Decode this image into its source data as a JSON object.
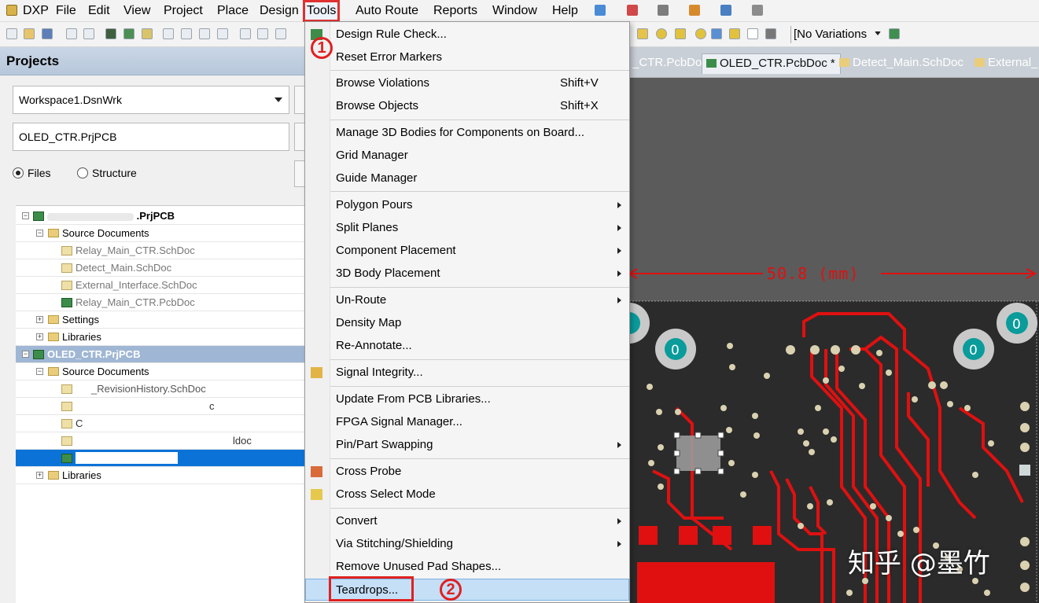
{
  "menubar": {
    "items": [
      "DXP",
      "File",
      "Edit",
      "View",
      "Project",
      "Place",
      "Design",
      "Tools",
      "Auto Route",
      "Reports",
      "Window",
      "Help"
    ],
    "active": "Tools"
  },
  "toolbar": {
    "variations": "[No Variations"
  },
  "projects": {
    "title": "Projects",
    "workspace": "Workspace1.DsnWrk",
    "project": "OLED_CTR.PrjPCB",
    "view_files": "Files",
    "view_structure": "Structure",
    "tree": {
      "project1": ".PrjPCB",
      "source_documents": "Source Documents",
      "settings": "Settings",
      "libraries": "Libraries",
      "p1_doc1": "Relay_Main_CTR.SchDoc",
      "p1_doc2": "Detect_Main.SchDoc",
      "p1_doc3": "External_Interface.SchDoc",
      "p1_doc4": "Relay_Main_CTR.PcbDoc",
      "project2": "OLED_CTR.PrjPCB",
      "p2_source_documents": "Source Documents",
      "p2_doc1": "_RevisionHistory.SchDoc",
      "p2_doc2": "c",
      "p2_doc3": "C",
      "p2_doc4": "ldoc",
      "p2_libraries": "Libraries"
    }
  },
  "tabs": [
    {
      "label": "_CTR.PcbDoc",
      "active": false
    },
    {
      "label": "OLED_CTR.PcbDoc *",
      "active": true
    },
    {
      "label": "Detect_Main.SchDoc",
      "active": false
    },
    {
      "label": "External_",
      "active": false
    }
  ],
  "canvas": {
    "dimension": "50.8 (mm)",
    "pad_label": "0",
    "watermark": "知乎 @墨竹"
  },
  "menu": {
    "items": [
      {
        "label": "Design Rule Check...",
        "shortcut": ""
      },
      {
        "label": "Reset Error Markers",
        "shortcut": ""
      },
      {
        "label": "Browse Violations",
        "shortcut": "Shift+V"
      },
      {
        "label": "Browse Objects",
        "shortcut": "Shift+X"
      },
      {
        "label": "Manage 3D Bodies for Components on Board...",
        "shortcut": ""
      },
      {
        "label": "Grid Manager",
        "shortcut": ""
      },
      {
        "label": "Guide Manager",
        "shortcut": ""
      },
      {
        "label": "Polygon Pours",
        "shortcut": ""
      },
      {
        "label": "Split Planes",
        "shortcut": ""
      },
      {
        "label": "Component Placement",
        "shortcut": ""
      },
      {
        "label": "3D Body Placement",
        "shortcut": ""
      },
      {
        "label": "Un-Route",
        "shortcut": ""
      },
      {
        "label": "Density Map",
        "shortcut": ""
      },
      {
        "label": "Re-Annotate...",
        "shortcut": ""
      },
      {
        "label": "Signal Integrity...",
        "shortcut": ""
      },
      {
        "label": "Update From PCB Libraries...",
        "shortcut": ""
      },
      {
        "label": "FPGA Signal Manager...",
        "shortcut": ""
      },
      {
        "label": "Pin/Part Swapping",
        "shortcut": ""
      },
      {
        "label": "Cross Probe",
        "shortcut": ""
      },
      {
        "label": "Cross Select Mode",
        "shortcut": ""
      },
      {
        "label": "Convert",
        "shortcut": ""
      },
      {
        "label": "Via Stitching/Shielding",
        "shortcut": ""
      },
      {
        "label": "Remove Unused Pad Shapes...",
        "shortcut": ""
      },
      {
        "label": "Teardrops...",
        "shortcut": ""
      }
    ],
    "highlighted": "Teardrops..."
  },
  "annotations": {
    "step1": "1",
    "step2": "2",
    "color": "#e02020"
  }
}
